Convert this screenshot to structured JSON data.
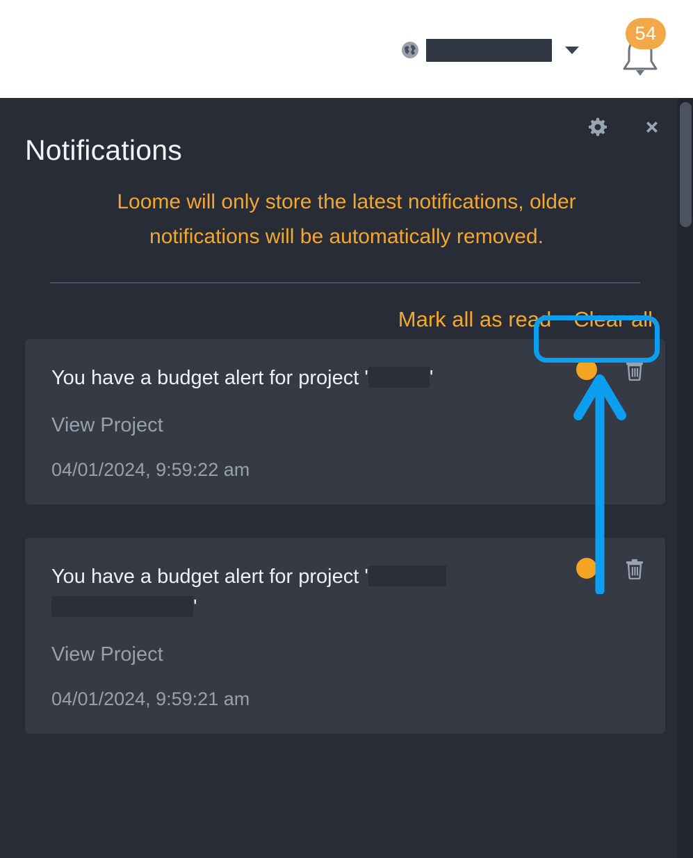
{
  "topbar": {
    "globe_icon": "globe-icon",
    "tenant_value": "",
    "tenant_placeholder": "",
    "dropdown_icon": "chevron-down-icon",
    "bell_icon": "bell-icon",
    "notification_count": "54"
  },
  "panel": {
    "title": "Notifications",
    "settings_icon": "gear-icon",
    "close_icon": "close-icon",
    "warning": "Loome will only store the latest notifications, older notifications will be automatically removed.",
    "actions": {
      "mark_all_read": "Mark all as read",
      "clear_all": "Clear all"
    }
  },
  "notifications": [
    {
      "message_prefix": "You have a budget alert for project '",
      "project_redacted": "",
      "message_suffix": "'",
      "link": "View Project",
      "timestamp": "04/01/2024, 9:59:22 am",
      "unread": true,
      "delete_icon": "trash-icon",
      "wrapped": false
    },
    {
      "message_prefix": "You have a budget alert for project '",
      "project_redacted": "",
      "message_suffix": "'",
      "link": "View Project",
      "timestamp": "04/01/2024, 9:59:21 am",
      "unread": true,
      "delete_icon": "trash-icon",
      "wrapped": true
    }
  ],
  "annotations": {
    "highlight_target": "clear-all",
    "arrow_icon": "up-arrow-annotation",
    "color": "#0d9ef0"
  },
  "colors": {
    "accent_orange": "#f3a72e",
    "badge_orange": "#f3a847",
    "panel_bg": "#282c36",
    "card_bg": "#353a45",
    "annotation_blue": "#0d9ef0",
    "muted_text": "#9aa0ab"
  },
  "scrollbar": {
    "position": "right",
    "thumb_top_pct": "0",
    "thumb_height_pct": "16"
  }
}
